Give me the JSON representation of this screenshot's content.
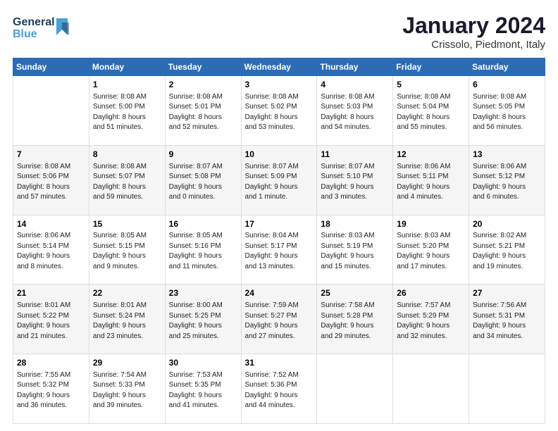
{
  "header": {
    "logo_line1": "General",
    "logo_line2": "Blue",
    "month_title": "January 2024",
    "location": "Crissolo, Piedmont, Italy"
  },
  "days_of_week": [
    "Sunday",
    "Monday",
    "Tuesday",
    "Wednesday",
    "Thursday",
    "Friday",
    "Saturday"
  ],
  "weeks": [
    [
      {
        "day": "",
        "info": ""
      },
      {
        "day": "1",
        "info": "Sunrise: 8:08 AM\nSunset: 5:00 PM\nDaylight: 8 hours\nand 51 minutes."
      },
      {
        "day": "2",
        "info": "Sunrise: 8:08 AM\nSunset: 5:01 PM\nDaylight: 8 hours\nand 52 minutes."
      },
      {
        "day": "3",
        "info": "Sunrise: 8:08 AM\nSunset: 5:02 PM\nDaylight: 8 hours\nand 53 minutes."
      },
      {
        "day": "4",
        "info": "Sunrise: 8:08 AM\nSunset: 5:03 PM\nDaylight: 8 hours\nand 54 minutes."
      },
      {
        "day": "5",
        "info": "Sunrise: 8:08 AM\nSunset: 5:04 PM\nDaylight: 8 hours\nand 55 minutes."
      },
      {
        "day": "6",
        "info": "Sunrise: 8:08 AM\nSunset: 5:05 PM\nDaylight: 8 hours\nand 56 minutes."
      }
    ],
    [
      {
        "day": "7",
        "info": "Sunrise: 8:08 AM\nSunset: 5:06 PM\nDaylight: 8 hours\nand 57 minutes."
      },
      {
        "day": "8",
        "info": "Sunrise: 8:08 AM\nSunset: 5:07 PM\nDaylight: 8 hours\nand 59 minutes."
      },
      {
        "day": "9",
        "info": "Sunrise: 8:07 AM\nSunset: 5:08 PM\nDaylight: 9 hours\nand 0 minutes."
      },
      {
        "day": "10",
        "info": "Sunrise: 8:07 AM\nSunset: 5:09 PM\nDaylight: 9 hours\nand 1 minute."
      },
      {
        "day": "11",
        "info": "Sunrise: 8:07 AM\nSunset: 5:10 PM\nDaylight: 9 hours\nand 3 minutes."
      },
      {
        "day": "12",
        "info": "Sunrise: 8:06 AM\nSunset: 5:11 PM\nDaylight: 9 hours\nand 4 minutes."
      },
      {
        "day": "13",
        "info": "Sunrise: 8:06 AM\nSunset: 5:12 PM\nDaylight: 9 hours\nand 6 minutes."
      }
    ],
    [
      {
        "day": "14",
        "info": "Sunrise: 8:06 AM\nSunset: 5:14 PM\nDaylight: 9 hours\nand 8 minutes."
      },
      {
        "day": "15",
        "info": "Sunrise: 8:05 AM\nSunset: 5:15 PM\nDaylight: 9 hours\nand 9 minutes."
      },
      {
        "day": "16",
        "info": "Sunrise: 8:05 AM\nSunset: 5:16 PM\nDaylight: 9 hours\nand 11 minutes."
      },
      {
        "day": "17",
        "info": "Sunrise: 8:04 AM\nSunset: 5:17 PM\nDaylight: 9 hours\nand 13 minutes."
      },
      {
        "day": "18",
        "info": "Sunrise: 8:03 AM\nSunset: 5:19 PM\nDaylight: 9 hours\nand 15 minutes."
      },
      {
        "day": "19",
        "info": "Sunrise: 8:03 AM\nSunset: 5:20 PM\nDaylight: 9 hours\nand 17 minutes."
      },
      {
        "day": "20",
        "info": "Sunrise: 8:02 AM\nSunset: 5:21 PM\nDaylight: 9 hours\nand 19 minutes."
      }
    ],
    [
      {
        "day": "21",
        "info": "Sunrise: 8:01 AM\nSunset: 5:22 PM\nDaylight: 9 hours\nand 21 minutes."
      },
      {
        "day": "22",
        "info": "Sunrise: 8:01 AM\nSunset: 5:24 PM\nDaylight: 9 hours\nand 23 minutes."
      },
      {
        "day": "23",
        "info": "Sunrise: 8:00 AM\nSunset: 5:25 PM\nDaylight: 9 hours\nand 25 minutes."
      },
      {
        "day": "24",
        "info": "Sunrise: 7:59 AM\nSunset: 5:27 PM\nDaylight: 9 hours\nand 27 minutes."
      },
      {
        "day": "25",
        "info": "Sunrise: 7:58 AM\nSunset: 5:28 PM\nDaylight: 9 hours\nand 29 minutes."
      },
      {
        "day": "26",
        "info": "Sunrise: 7:57 AM\nSunset: 5:29 PM\nDaylight: 9 hours\nand 32 minutes."
      },
      {
        "day": "27",
        "info": "Sunrise: 7:56 AM\nSunset: 5:31 PM\nDaylight: 9 hours\nand 34 minutes."
      }
    ],
    [
      {
        "day": "28",
        "info": "Sunrise: 7:55 AM\nSunset: 5:32 PM\nDaylight: 9 hours\nand 36 minutes."
      },
      {
        "day": "29",
        "info": "Sunrise: 7:54 AM\nSunset: 5:33 PM\nDaylight: 9 hours\nand 39 minutes."
      },
      {
        "day": "30",
        "info": "Sunrise: 7:53 AM\nSunset: 5:35 PM\nDaylight: 9 hours\nand 41 minutes."
      },
      {
        "day": "31",
        "info": "Sunrise: 7:52 AM\nSunset: 5:36 PM\nDaylight: 9 hours\nand 44 minutes."
      },
      {
        "day": "",
        "info": ""
      },
      {
        "day": "",
        "info": ""
      },
      {
        "day": "",
        "info": ""
      }
    ]
  ]
}
